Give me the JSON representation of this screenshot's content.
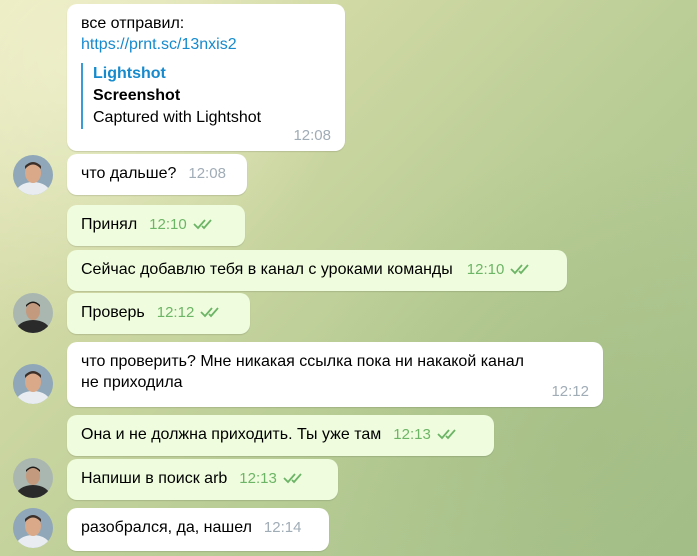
{
  "messages": [
    {
      "text": "все отправил:",
      "link": "https://prnt.sc/13nxis2",
      "preview": {
        "site": "Lightshot",
        "title": "Screenshot",
        "description": "Captured with Lightshot"
      },
      "time": "12:08",
      "direction": "in"
    },
    {
      "text": "что дальше?",
      "time": "12:08",
      "direction": "in"
    },
    {
      "text": "Принял",
      "time": "12:10",
      "direction": "out"
    },
    {
      "text": "Сейчас добавлю тебя в канал с уроками команды",
      "time": "12:10",
      "direction": "out"
    },
    {
      "text": "Проверь",
      "time": "12:12",
      "direction": "out"
    },
    {
      "text": "что проверить? Мне никакая ссылка пока ни накакой канал не приходила",
      "time": "12:12",
      "direction": "in"
    },
    {
      "text": "Она и не должна приходить. Ты уже там",
      "time": "12:13",
      "direction": "out"
    },
    {
      "text": "Напиши в поиск arb",
      "time": "12:13",
      "direction": "out"
    },
    {
      "text": "разобрался, да, нашел",
      "time": "12:14",
      "direction": "in"
    }
  ],
  "colors": {
    "incoming_bubble": "#ffffff",
    "outgoing_bubble": "#effdde",
    "link": "#168acd",
    "read_check": "#6db566"
  },
  "icons": {
    "read_receipt": "double-check-icon",
    "avatar_a": "user-avatar-light-shirt",
    "avatar_b": "user-avatar-dark-shirt"
  }
}
